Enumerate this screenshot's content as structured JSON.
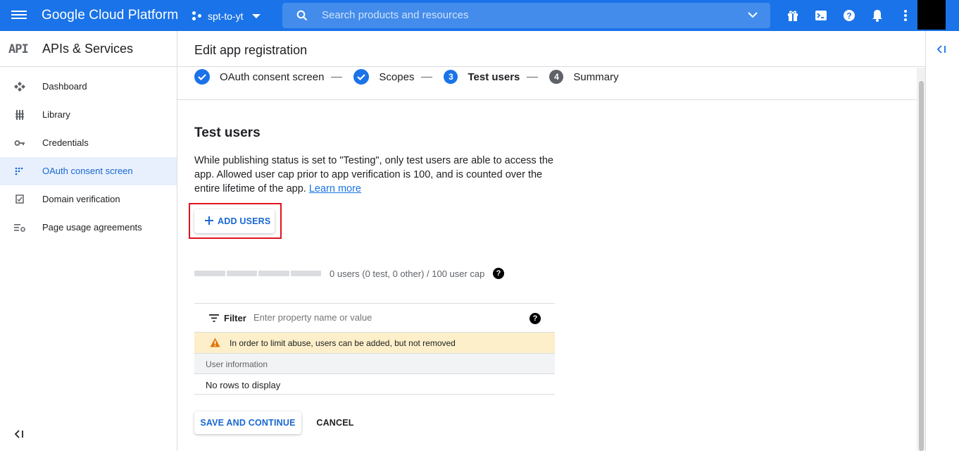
{
  "topbar": {
    "brand": "Google Cloud Platform",
    "project": "spt-to-yt",
    "search_placeholder": "Search products and resources",
    "color": "#1a73e8"
  },
  "sidebar": {
    "logo": "API",
    "title": "APIs & Services",
    "items": [
      {
        "label": "Dashboard",
        "icon": "dashboard-icon"
      },
      {
        "label": "Library",
        "icon": "library-icon"
      },
      {
        "label": "Credentials",
        "icon": "key-icon"
      },
      {
        "label": "OAuth consent screen",
        "icon": "consent-icon",
        "active": true
      },
      {
        "label": "Domain verification",
        "icon": "checkbox-icon"
      },
      {
        "label": "Page usage agreements",
        "icon": "settings-list-icon"
      }
    ]
  },
  "main": {
    "title": "Edit app registration",
    "steps": [
      {
        "label": "OAuth consent screen",
        "state": "done"
      },
      {
        "label": "Scopes",
        "state": "done"
      },
      {
        "number": "3",
        "label": "Test users",
        "state": "current"
      },
      {
        "number": "4",
        "label": "Summary",
        "state": "upcoming"
      }
    ],
    "section_title": "Test users",
    "description": "While publishing status is set to \"Testing\", only test users are able to access the app. Allowed user cap prior to app verification is 100, and is counted over the entire lifetime of the app.",
    "learn_more": "Learn more",
    "add_users": "ADD USERS",
    "cap_text": "0 users (0 test, 0 other) / 100 user cap",
    "cap_fill_fraction": 0,
    "table": {
      "filter_label": "Filter",
      "filter_placeholder": "Enter property name or value",
      "warning": "In order to limit abuse, users can be added, but not removed",
      "column_header": "User information",
      "empty_text": "No rows to display"
    },
    "save_button": "SAVE AND CONTINUE",
    "cancel_button": "CANCEL"
  }
}
